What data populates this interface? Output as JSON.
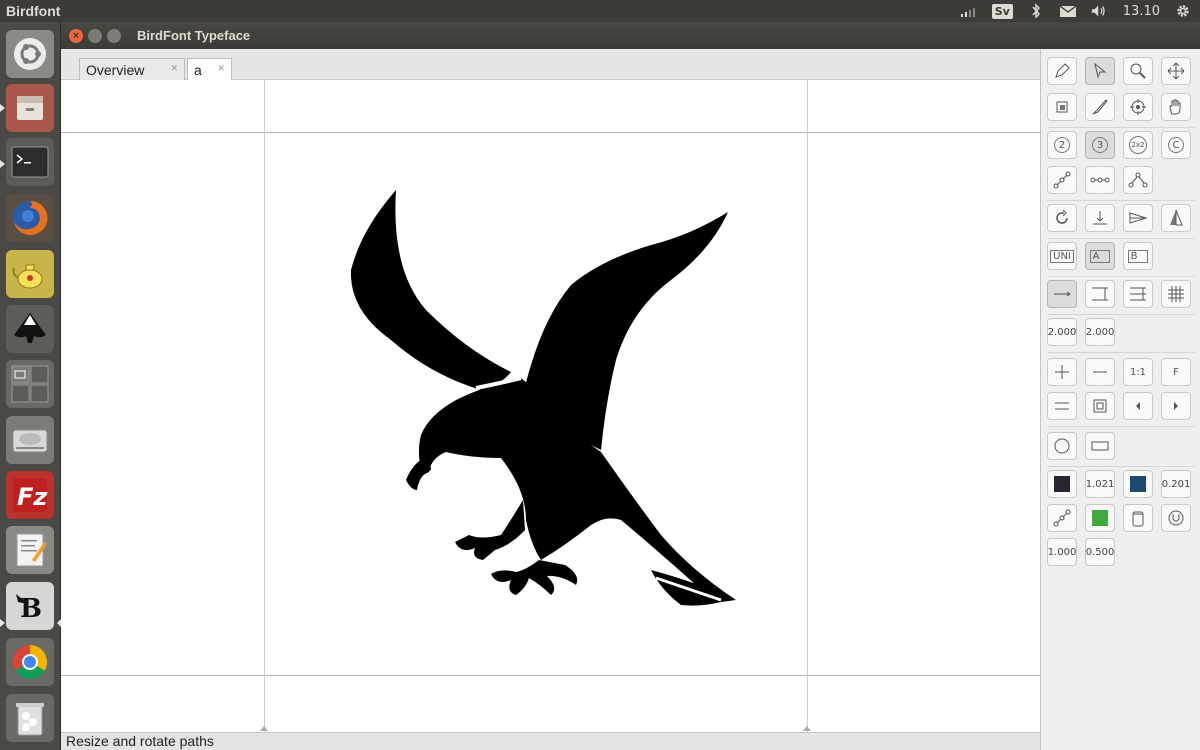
{
  "panel": {
    "app_name": "Birdfont",
    "keyboard_layout": "Sv",
    "clock": "13.10",
    "tray_icons": [
      "network-icon",
      "keyboard-icon",
      "bluetooth-icon",
      "mail-icon",
      "volume-icon",
      "clock",
      "settings-gear-icon"
    ]
  },
  "launcher": {
    "items": [
      {
        "name": "ubuntu-dash-icon"
      },
      {
        "name": "files-icon"
      },
      {
        "name": "terminal-icon"
      },
      {
        "name": "firefox-icon"
      },
      {
        "name": "teapot-app-icon"
      },
      {
        "name": "inkscape-icon"
      },
      {
        "name": "workspace-switcher-icon"
      },
      {
        "name": "disk-drive-icon"
      },
      {
        "name": "filezilla-icon"
      },
      {
        "name": "text-editor-icon"
      },
      {
        "name": "birdfont-icon"
      },
      {
        "name": "chrome-icon"
      },
      {
        "name": "trash-icon"
      }
    ]
  },
  "window": {
    "title": "BirdFont Typeface"
  },
  "tabs": [
    {
      "label": "Overview",
      "active": false
    },
    {
      "label": "a",
      "active": true
    }
  ],
  "canvas": {
    "glyph_name": "eagle-glyph"
  },
  "status": {
    "text": "Resize and rotate paths"
  },
  "tools": {
    "text_labels": {
      "point_2": "2",
      "point_3": "3",
      "grid_2x2": "2x2",
      "curve_c": "C",
      "uni": "UNI",
      "letter_a": "A",
      "letter_b": "B",
      "stroke_1": "2.000",
      "stroke_2": "2.000",
      "one_to_one": "1:1",
      "fit": "F",
      "size_1": "1.021",
      "size_2": "0.201",
      "scale_1": "1.000",
      "scale_2": "0.500"
    },
    "colors": {
      "fill_dark": "#2b2433",
      "fill_blue": "#1e4a6e",
      "fill_green": "#3faa3a"
    }
  }
}
